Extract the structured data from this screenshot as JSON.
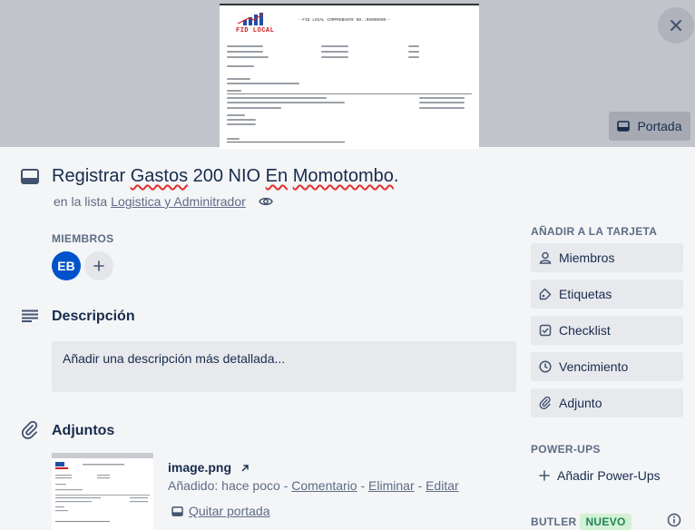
{
  "cover": {
    "doc_brand": "FID LOCAL",
    "doc_title": "--FID LOCAL COMPROBANTE NO.:00000000--",
    "cover_button_label": "Portada"
  },
  "card": {
    "title_parts": [
      "Registrar ",
      "Gastos",
      " 200 NIO ",
      "En",
      " ",
      "Momotombo",
      "."
    ],
    "in_list_prefix": "en la lista",
    "list_name": "Logistica y Adminitrador"
  },
  "members": {
    "label": "MIEMBROS",
    "avatar_initials": "EB"
  },
  "description": {
    "heading": "Descripción",
    "placeholder": "Añadir una descripción más detallada..."
  },
  "attachments": {
    "heading": "Adjuntos",
    "file_name": "image.png",
    "added_label": "Añadido: hace poco",
    "sep": " - ",
    "comment_link": "Comentario",
    "delete_link": "Eliminar",
    "edit_link": "Editar",
    "remove_cover": "Quitar portada"
  },
  "sidebar": {
    "add_to_card_label": "AÑADIR A LA TARJETA",
    "buttons": [
      {
        "label": "Miembros",
        "icon": "person-icon"
      },
      {
        "label": "Etiquetas",
        "icon": "tag-icon"
      },
      {
        "label": "Checklist",
        "icon": "checklist-icon"
      },
      {
        "label": "Vencimiento",
        "icon": "clock-icon"
      },
      {
        "label": "Adjunto",
        "icon": "paperclip-icon"
      }
    ],
    "powerups_label": "POWER-UPS",
    "add_powerups": "Añadir Power-Ups",
    "butler_label": "BUTLER",
    "new_badge": "NUEVO"
  },
  "colors": {
    "accent": "#0052cc",
    "badge_bg": "#d3f1d4",
    "badge_fg": "#1f845a",
    "cover_bg": "#c2c4cc"
  }
}
